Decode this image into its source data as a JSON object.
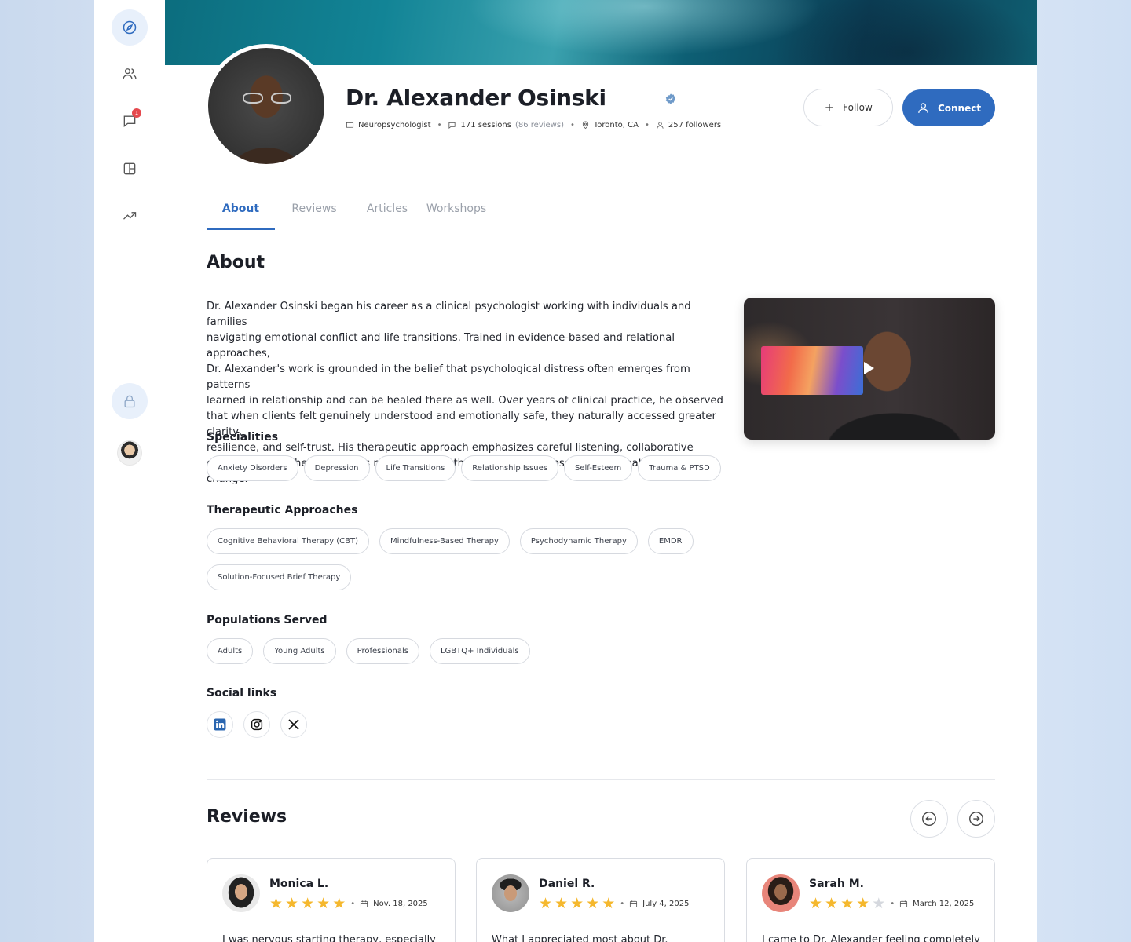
{
  "sidebar": {
    "items": [
      {
        "icon": "compass-icon",
        "active": true
      },
      {
        "icon": "users-icon"
      },
      {
        "icon": "chat-icon",
        "badge": "1"
      },
      {
        "icon": "layout-icon"
      },
      {
        "icon": "trending-icon"
      }
    ],
    "lock_icon": "lock-icon"
  },
  "profile": {
    "name": "Dr. Alexander Osinski",
    "role": "Neuropsychologist",
    "sessions": "171 sessions",
    "reviews_count": "(86 reviews)",
    "location": "Toronto, CA",
    "followers": "257 followers"
  },
  "actions": {
    "follow_label": "Follow",
    "connect_label": "Connect"
  },
  "tabs": [
    {
      "label": "About",
      "active": true
    },
    {
      "label": "Reviews"
    },
    {
      "label": "Articles"
    },
    {
      "label": "Workshops"
    }
  ],
  "about": {
    "heading": "About",
    "lines": [
      "Dr. Alexander Osinski began his career as a clinical psychologist working with individuals and families",
      "navigating emotional conflict and life transitions. Trained in evidence-based and relational approaches,",
      "Dr. Alexander's work is grounded in the belief that psychological distress often emerges from patterns",
      "learned in relationship and can be healed there as well. Over years of clinical practice, he observed",
      "that when clients felt genuinely understood and emotionally safe, they naturally accessed greater clarity,",
      "resilience, and self-trust. His therapeutic approach emphasizes careful listening, collaborative",
      "exploration, and helping clients reconnect with their own internal resources to create lasting change."
    ]
  },
  "specialities": {
    "title": "Specialities",
    "items": [
      "Anxiety Disorders",
      "Depression",
      "Life Transitions",
      "Relationship Issues",
      "Self-Esteem",
      "Trauma & PTSD"
    ]
  },
  "approaches": {
    "title": "Therapeutic Approaches",
    "items": [
      "Cognitive Behavioral Therapy (CBT)",
      "Mindfulness-Based Therapy",
      "Psychodynamic Therapy",
      "EMDR",
      "Solution-Focused Brief Therapy"
    ]
  },
  "populations": {
    "title": "Populations Served",
    "items": [
      "Adults",
      "Young Adults",
      "Professionals",
      "LGBTQ+ Individuals"
    ]
  },
  "social": {
    "title": "Social links",
    "items": [
      "linkedin-icon",
      "instagram-icon",
      "x-icon"
    ]
  },
  "reviews": {
    "heading": "Reviews",
    "items": [
      {
        "name": "Monica L.",
        "rating": 5,
        "date": "Nov. 18, 2025",
        "text": "I was nervous starting therapy, especially"
      },
      {
        "name": "Daniel R.",
        "rating": 5,
        "date": "July 4, 2025",
        "text": "What I appreciated most about Dr."
      },
      {
        "name": "Sarah M.",
        "rating": 4,
        "date": "March 12, 2025",
        "text": "I came to Dr. Alexander feeling completely"
      }
    ]
  },
  "colors": {
    "accent": "#2f6bbf",
    "star": "#f5b82e",
    "badge": "#e5484d"
  }
}
